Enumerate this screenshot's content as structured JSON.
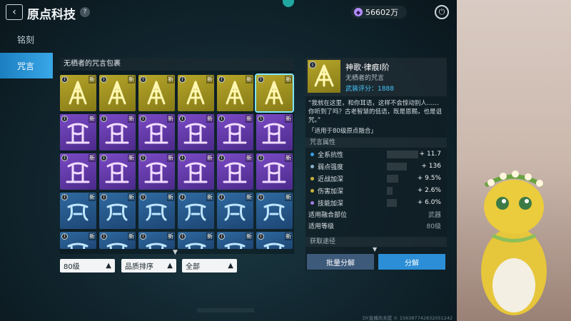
{
  "header": {
    "title": "原点科技",
    "help": "?",
    "currency_value": "56602万"
  },
  "sidebar": {
    "items": [
      {
        "label": "铭刻",
        "active": false
      },
      {
        "label": "咒言",
        "active": true
      }
    ]
  },
  "inventory": {
    "title": "无栖者的咒言包裹",
    "rows": [
      {
        "tier": "gold",
        "cells": 6
      },
      {
        "tier": "purple",
        "cells": 6
      },
      {
        "tier": "purple",
        "cells": 6
      },
      {
        "tier": "blue",
        "cells": 6
      },
      {
        "tier": "blue",
        "cells": 6,
        "partial": true
      }
    ],
    "level_badge": "I",
    "new_label": "新",
    "selected_index": 5
  },
  "filters": {
    "level": "80级",
    "sort": "品质排序",
    "category": "全部"
  },
  "detail": {
    "badge": "I",
    "name": "神歌·律痕I阶",
    "subtitle": "无栖者的咒言",
    "score_label": "武装评分：",
    "score_value": "1888",
    "quote": "“我就在这里，和你耳语，这样不会惊动别人……你听到了吗？古老智慧的低语，既是恩赐，也是诅咒。”",
    "fusion_note": "「适用于80级原点融合」",
    "attr_section": "咒言属性",
    "attributes": [
      {
        "name": "全系抗性",
        "value": "+ 11.7",
        "color": "#3aa0e8",
        "fill": 0.55
      },
      {
        "name": "弱点强度",
        "value": "+ 136",
        "color": "#8bb0c8",
        "fill": 0.35
      },
      {
        "name": "近战加深",
        "value": "+ 9.5%",
        "color": "#c8b23c",
        "fill": 0.2
      },
      {
        "name": "伤害加深",
        "value": "+ 2.6%",
        "color": "#c8b23c",
        "fill": 0.1
      },
      {
        "name": "技能加深",
        "value": "+ 6.0%",
        "color": "#a07ce0",
        "fill": 0.18
      }
    ],
    "fusion_slot_label": "适用融合部位",
    "fusion_slot_value": "武器",
    "level_label": "适用等级",
    "level_value": "80级",
    "obtain_label": "获取途径",
    "btn_batch": "批量分解",
    "btn_decompose": "分解"
  },
  "footer": {
    "stream_id": "DY直播尚未提    © 156387742832051242"
  },
  "colors": {
    "accent": "#2c8ed6",
    "gold": "#b7a62a",
    "purple": "#7b4ac6",
    "blue": "#2f6aa1",
    "score": "#46c8ff"
  },
  "icons": [
    "back-icon",
    "help-icon",
    "coin-icon",
    "power-icon",
    "rune-icon",
    "chevron-up-icon",
    "chevron-down-icon"
  ]
}
